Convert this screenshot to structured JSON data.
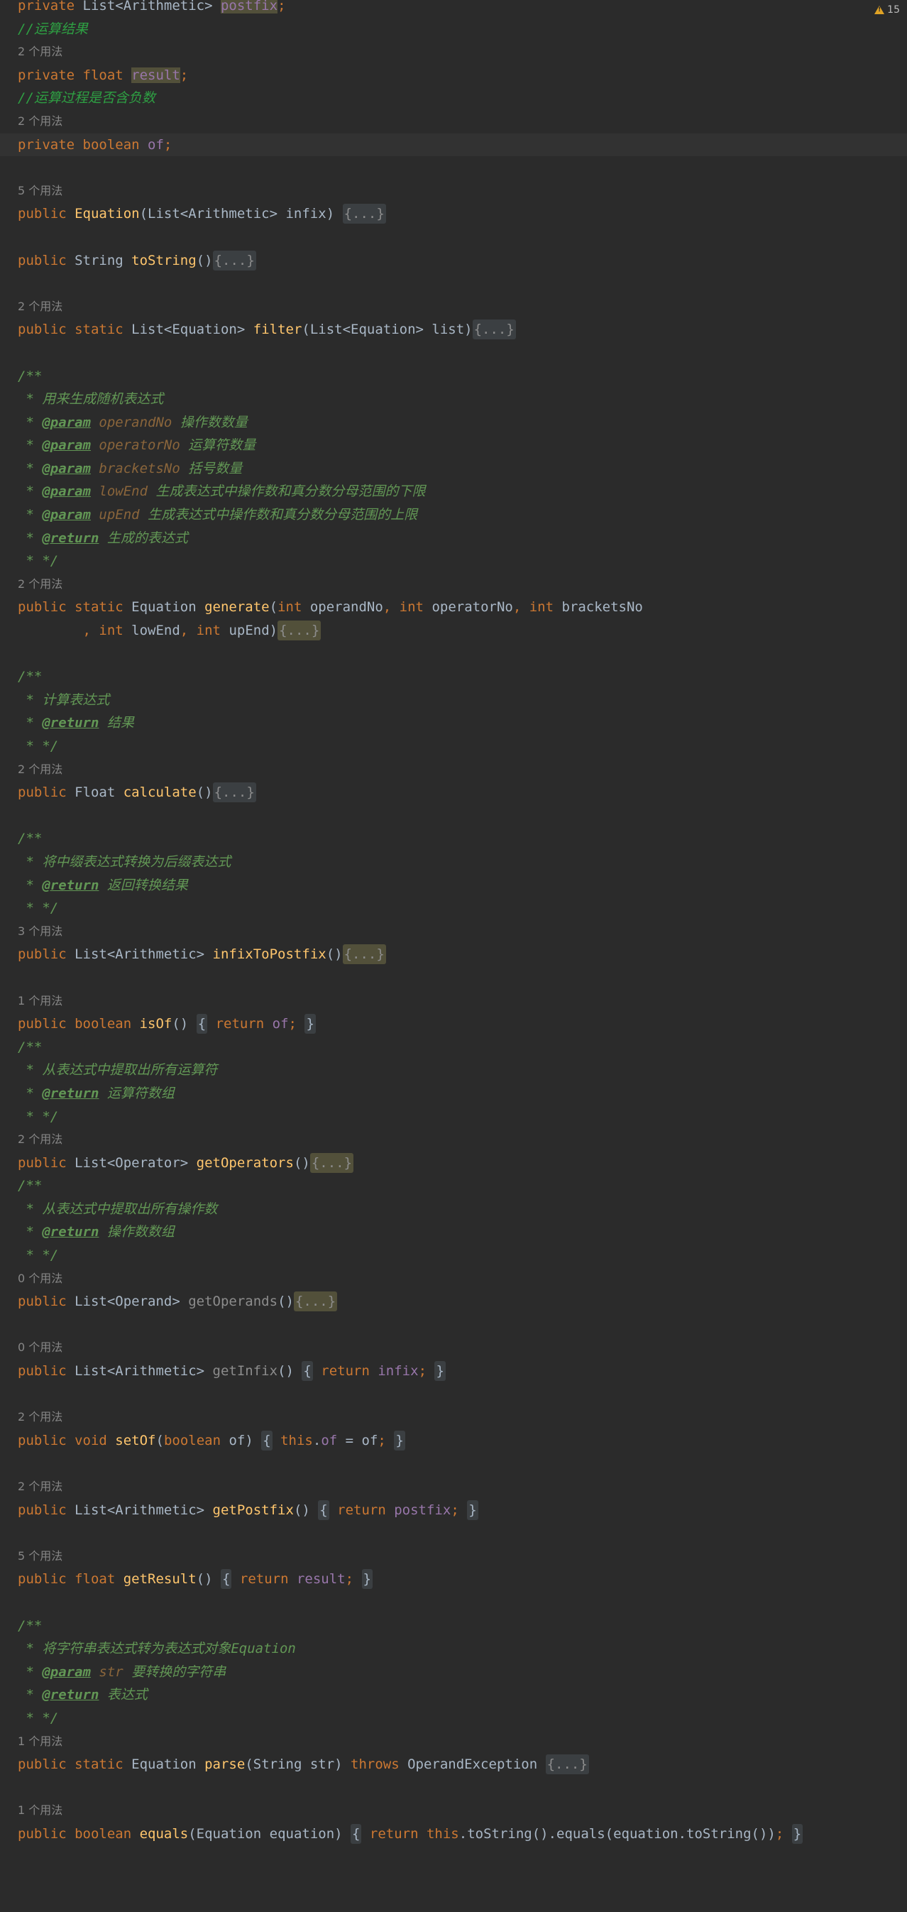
{
  "inspections": {
    "warning_count": "15"
  },
  "lines": [
    {
      "s": [
        [
          "kw",
          "private "
        ],
        [
          "plain",
          "List<Arithmetic> "
        ],
        [
          "hl-write",
          "postfix"
        ],
        [
          "kw",
          ";"
        ]
      ]
    },
    {
      "s": [
        [
          "lcmt",
          "//运算结果"
        ]
      ]
    },
    {
      "hint": "2 个用法"
    },
    {
      "s": [
        [
          "kw",
          "private float "
        ],
        [
          "hl-write",
          "result"
        ],
        [
          "kw",
          ";"
        ]
      ]
    },
    {
      "s": [
        [
          "lcmt",
          "//运算过程是否含负数"
        ]
      ]
    },
    {
      "hint": "2 个用法"
    },
    {
      "current": true,
      "s": [
        [
          "kw",
          "private boolean "
        ],
        [
          "fld",
          "of"
        ],
        [
          "kw",
          ";"
        ]
      ]
    },
    {
      "blank": true
    },
    {
      "hint": "5 个用法"
    },
    {
      "s": [
        [
          "kw",
          "public "
        ],
        [
          "fn",
          "Equation"
        ],
        [
          "plain",
          "(List<Arithmetic> infix) "
        ],
        [
          "fold",
          "{...}"
        ]
      ]
    },
    {
      "blank": true
    },
    {
      "s": [
        [
          "kw",
          "public "
        ],
        [
          "plain",
          "String "
        ],
        [
          "fn",
          "toString"
        ],
        [
          "plain",
          "()"
        ],
        [
          "fold",
          "{...}"
        ]
      ]
    },
    {
      "blank": true
    },
    {
      "hint": "2 个用法"
    },
    {
      "s": [
        [
          "kw",
          "public static "
        ],
        [
          "plain",
          "List<Equation> "
        ],
        [
          "fn",
          "filter"
        ],
        [
          "plain",
          "(List<Equation> list)"
        ],
        [
          "fold",
          "{...}"
        ]
      ]
    },
    {
      "blank": true
    },
    {
      "s": [
        [
          "cmt",
          "/**"
        ]
      ]
    },
    {
      "s": [
        [
          "cmt",
          " * 用来生成随机表达式"
        ]
      ]
    },
    {
      "s": [
        [
          "cmt",
          " * "
        ],
        [
          "tag",
          "@param"
        ],
        [
          "cmt",
          " "
        ],
        [
          "pname",
          "operandNo"
        ],
        [
          "cmt",
          " 操作数数量"
        ]
      ]
    },
    {
      "s": [
        [
          "cmt",
          " * "
        ],
        [
          "tag",
          "@param"
        ],
        [
          "cmt",
          " "
        ],
        [
          "pname",
          "operatorNo"
        ],
        [
          "cmt",
          " 运算符数量"
        ]
      ]
    },
    {
      "s": [
        [
          "cmt",
          " * "
        ],
        [
          "tag",
          "@param"
        ],
        [
          "cmt",
          " "
        ],
        [
          "pname",
          "bracketsNo"
        ],
        [
          "cmt",
          " 括号数量"
        ]
      ]
    },
    {
      "s": [
        [
          "cmt",
          " * "
        ],
        [
          "tag",
          "@param"
        ],
        [
          "cmt",
          " "
        ],
        [
          "pname",
          "lowEnd"
        ],
        [
          "cmt",
          " 生成表达式中操作数和真分数分母范围的下限"
        ]
      ]
    },
    {
      "s": [
        [
          "cmt",
          " * "
        ],
        [
          "tag",
          "@param"
        ],
        [
          "cmt",
          " "
        ],
        [
          "pname",
          "upEnd"
        ],
        [
          "cmt",
          " 生成表达式中操作数和真分数分母范围的上限"
        ]
      ]
    },
    {
      "s": [
        [
          "cmt",
          " * "
        ],
        [
          "tag",
          "@return"
        ],
        [
          "cmt",
          " 生成的表达式"
        ]
      ]
    },
    {
      "s": [
        [
          "cmt",
          " * */"
        ]
      ]
    },
    {
      "hint": "2 个用法"
    },
    {
      "s": [
        [
          "kw",
          "public static "
        ],
        [
          "plain",
          "Equation "
        ],
        [
          "fn",
          "generate"
        ],
        [
          "plain",
          "("
        ],
        [
          "kw",
          "int "
        ],
        [
          "plain",
          "operandNo"
        ],
        [
          "kw",
          ", int "
        ],
        [
          "plain",
          "operatorNo"
        ],
        [
          "kw",
          ", int "
        ],
        [
          "plain",
          "bracketsNo"
        ]
      ]
    },
    {
      "s": [
        [
          "kw",
          "        , int "
        ],
        [
          "plain",
          "lowEnd"
        ],
        [
          "kw",
          ", int "
        ],
        [
          "plain",
          "upEnd)"
        ],
        [
          "fold-hl",
          "{...}"
        ]
      ]
    },
    {
      "blank": true
    },
    {
      "s": [
        [
          "cmt",
          "/**"
        ]
      ]
    },
    {
      "s": [
        [
          "cmt",
          " * 计算表达式"
        ]
      ]
    },
    {
      "s": [
        [
          "cmt",
          " * "
        ],
        [
          "tag",
          "@return"
        ],
        [
          "cmt",
          " 结果"
        ]
      ]
    },
    {
      "s": [
        [
          "cmt",
          " * */"
        ]
      ]
    },
    {
      "hint": "2 个用法"
    },
    {
      "s": [
        [
          "kw",
          "public "
        ],
        [
          "plain",
          "Float "
        ],
        [
          "fn",
          "calculate"
        ],
        [
          "plain",
          "()"
        ],
        [
          "fold",
          "{...}"
        ]
      ]
    },
    {
      "blank": true
    },
    {
      "s": [
        [
          "cmt",
          "/**"
        ]
      ]
    },
    {
      "s": [
        [
          "cmt",
          " * 将中缀表达式转换为后缀表达式"
        ]
      ]
    },
    {
      "s": [
        [
          "cmt",
          " * "
        ],
        [
          "tag",
          "@return"
        ],
        [
          "cmt",
          " 返回转换结果"
        ]
      ]
    },
    {
      "s": [
        [
          "cmt",
          " * */"
        ]
      ]
    },
    {
      "hint": "3 个用法"
    },
    {
      "s": [
        [
          "kw",
          "public "
        ],
        [
          "plain",
          "List<Arithmetic> "
        ],
        [
          "fn",
          "infixToPostfix"
        ],
        [
          "plain",
          "()"
        ],
        [
          "fold-hl",
          "{...}"
        ]
      ]
    },
    {
      "blank": true
    },
    {
      "hint": "1 个用法"
    },
    {
      "s": [
        [
          "kw",
          "public boolean "
        ],
        [
          "fn",
          "isOf"
        ],
        [
          "plain",
          "() "
        ],
        [
          "brace",
          "{"
        ],
        [
          "kw",
          " return "
        ],
        [
          "fld",
          "of"
        ],
        [
          "kw",
          ";"
        ],
        [
          "plain",
          " "
        ],
        [
          "brace",
          "}"
        ]
      ]
    },
    {
      "s": [
        [
          "cmt",
          "/**"
        ]
      ]
    },
    {
      "s": [
        [
          "cmt",
          " * 从表达式中提取出所有运算符"
        ]
      ]
    },
    {
      "s": [
        [
          "cmt",
          " * "
        ],
        [
          "tag",
          "@return"
        ],
        [
          "cmt",
          " 运算符数组"
        ]
      ]
    },
    {
      "s": [
        [
          "cmt",
          " * */"
        ]
      ]
    },
    {
      "hint": "2 个用法"
    },
    {
      "s": [
        [
          "kw",
          "public "
        ],
        [
          "plain",
          "List<Operator> "
        ],
        [
          "fn",
          "getOperators"
        ],
        [
          "plain",
          "()"
        ],
        [
          "fold-hl",
          "{...}"
        ]
      ]
    },
    {
      "s": [
        [
          "cmt",
          "/**"
        ]
      ]
    },
    {
      "s": [
        [
          "cmt",
          " * 从表达式中提取出所有操作数"
        ]
      ]
    },
    {
      "s": [
        [
          "cmt",
          " * "
        ],
        [
          "tag",
          "@return"
        ],
        [
          "cmt",
          " 操作数数组"
        ]
      ]
    },
    {
      "s": [
        [
          "cmt",
          " * */"
        ]
      ]
    },
    {
      "hint": "0 个用法"
    },
    {
      "s": [
        [
          "kw",
          "public "
        ],
        [
          "plain",
          "List<Operand> "
        ],
        [
          "unused",
          "getOperands"
        ],
        [
          "plain",
          "()"
        ],
        [
          "fold-hl",
          "{...}"
        ]
      ]
    },
    {
      "blank": true
    },
    {
      "hint": "0 个用法"
    },
    {
      "s": [
        [
          "kw",
          "public "
        ],
        [
          "plain",
          "List<Arithmetic> "
        ],
        [
          "unused",
          "getInfix"
        ],
        [
          "plain",
          "() "
        ],
        [
          "brace",
          "{"
        ],
        [
          "kw",
          " return "
        ],
        [
          "fld",
          "infix"
        ],
        [
          "kw",
          ";"
        ],
        [
          "plain",
          " "
        ],
        [
          "brace",
          "}"
        ]
      ]
    },
    {
      "blank": true
    },
    {
      "hint": "2 个用法"
    },
    {
      "s": [
        [
          "kw",
          "public void "
        ],
        [
          "fn",
          "setOf"
        ],
        [
          "plain",
          "("
        ],
        [
          "kw",
          "boolean "
        ],
        [
          "plain",
          "of) "
        ],
        [
          "brace",
          "{"
        ],
        [
          "kw",
          " this"
        ],
        [
          "plain",
          "."
        ],
        [
          "fld",
          "of"
        ],
        [
          "plain",
          " = of"
        ],
        [
          "kw",
          ";"
        ],
        [
          "plain",
          " "
        ],
        [
          "brace",
          "}"
        ]
      ]
    },
    {
      "blank": true
    },
    {
      "hint": "2 个用法"
    },
    {
      "s": [
        [
          "kw",
          "public "
        ],
        [
          "plain",
          "List<Arithmetic> "
        ],
        [
          "fn",
          "getPostfix"
        ],
        [
          "plain",
          "() "
        ],
        [
          "brace",
          "{"
        ],
        [
          "kw",
          " return "
        ],
        [
          "fld",
          "postfix"
        ],
        [
          "kw",
          ";"
        ],
        [
          "plain",
          " "
        ],
        [
          "brace",
          "}"
        ]
      ]
    },
    {
      "blank": true
    },
    {
      "hint": "5 个用法"
    },
    {
      "s": [
        [
          "kw",
          "public float "
        ],
        [
          "fn",
          "getResult"
        ],
        [
          "plain",
          "() "
        ],
        [
          "brace",
          "{"
        ],
        [
          "kw",
          " return "
        ],
        [
          "fld",
          "result"
        ],
        [
          "kw",
          ";"
        ],
        [
          "plain",
          " "
        ],
        [
          "brace",
          "}"
        ]
      ]
    },
    {
      "blank": true
    },
    {
      "s": [
        [
          "cmt",
          "/**"
        ]
      ]
    },
    {
      "s": [
        [
          "cmt",
          " * 将字符串表达式转为表达式对象Equation"
        ]
      ]
    },
    {
      "s": [
        [
          "cmt",
          " * "
        ],
        [
          "tag",
          "@param"
        ],
        [
          "cmt",
          " "
        ],
        [
          "pname",
          "str"
        ],
        [
          "cmt",
          " 要转换的字符串"
        ]
      ]
    },
    {
      "s": [
        [
          "cmt",
          " * "
        ],
        [
          "tag",
          "@return"
        ],
        [
          "cmt",
          " 表达式"
        ]
      ]
    },
    {
      "s": [
        [
          "cmt",
          " * */"
        ]
      ]
    },
    {
      "hint": "1 个用法"
    },
    {
      "s": [
        [
          "kw",
          "public static "
        ],
        [
          "plain",
          "Equation "
        ],
        [
          "fn",
          "parse"
        ],
        [
          "plain",
          "(String str) "
        ],
        [
          "kw",
          "throws "
        ],
        [
          "plain",
          "OperandException "
        ],
        [
          "fold",
          "{...}"
        ]
      ]
    },
    {
      "blank": true
    },
    {
      "hint": "1 个用法"
    },
    {
      "s": [
        [
          "kw",
          "public boolean "
        ],
        [
          "fn",
          "equals"
        ],
        [
          "plain",
          "(Equation equation) "
        ],
        [
          "brace",
          "{"
        ],
        [
          "kw",
          " return this"
        ],
        [
          "plain",
          ".toString().equals(equation.toString())"
        ],
        [
          "kw",
          ";"
        ],
        [
          "plain",
          " "
        ],
        [
          "brace",
          "}"
        ]
      ]
    }
  ]
}
